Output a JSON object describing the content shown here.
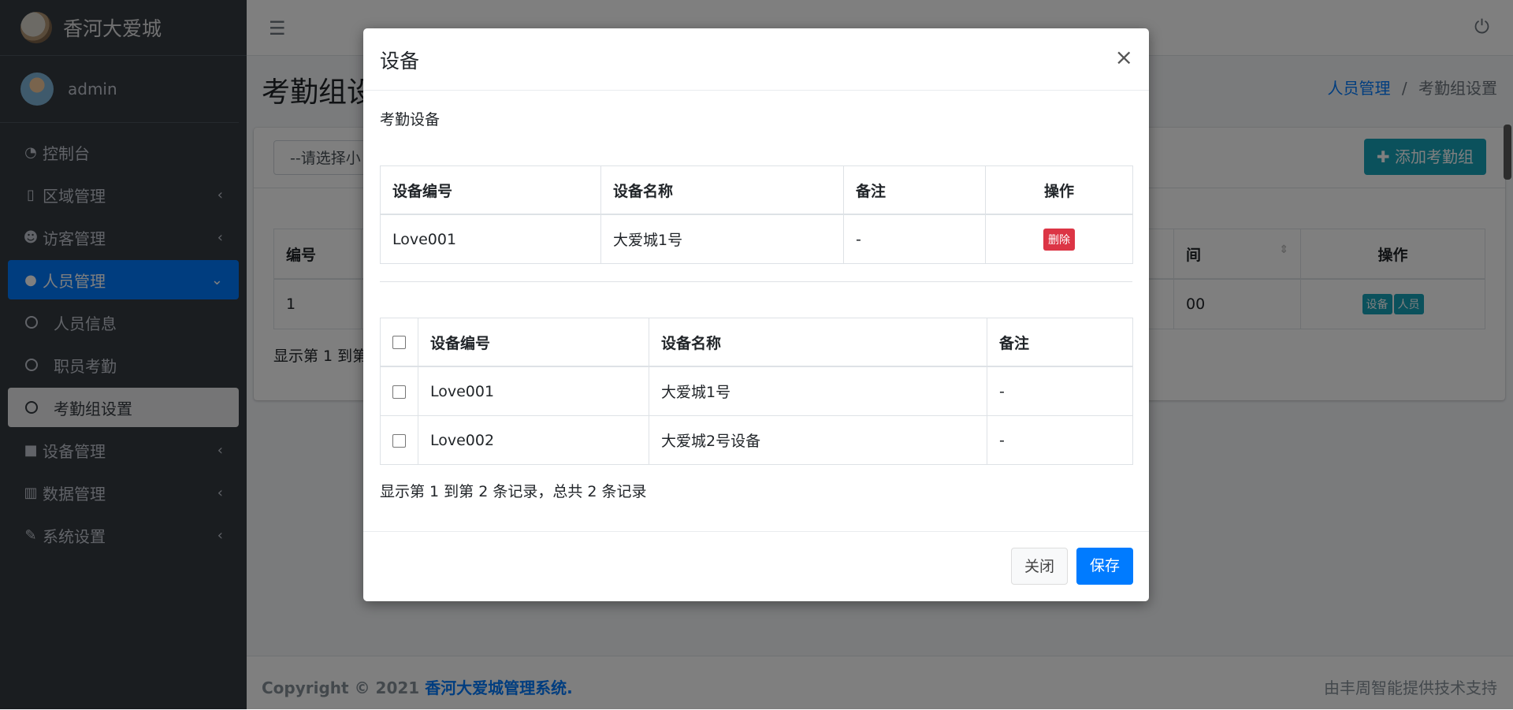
{
  "brand": {
    "name": "香河大爱城"
  },
  "user": {
    "name": "admin"
  },
  "sidebar": {
    "items": [
      {
        "label": "控制台",
        "icon": "dashboard-icon"
      },
      {
        "label": "区域管理",
        "icon": "building-icon"
      },
      {
        "label": "访客管理",
        "icon": "user-check-icon"
      },
      {
        "label": "人员管理",
        "icon": "user-icon"
      },
      {
        "label": "人员信息"
      },
      {
        "label": "职员考勤"
      },
      {
        "label": "考勤组设置"
      },
      {
        "label": "设备管理",
        "icon": "video-icon"
      },
      {
        "label": "数据管理",
        "icon": "chart-icon"
      },
      {
        "label": "系统设置",
        "icon": "wrench-icon"
      }
    ]
  },
  "page": {
    "title": "考勤组设",
    "breadcrumb": {
      "parent": "人员管理",
      "separator": "/",
      "current": "考勤组设置"
    },
    "filter_placeholder": "--请选择小",
    "add_button": "添加考勤组",
    "table": {
      "headers": [
        "编号",
        "间",
        "操作"
      ],
      "row": {
        "id": "1",
        "time": "00",
        "btn_device": "设备",
        "btn_person": "人员"
      }
    },
    "info": "显示第 1 到第"
  },
  "footer": {
    "copyright": "Copyright © 2021",
    "system_name": "香河大爱城管理系统.",
    "support": "由丰周智能提供技术支持"
  },
  "modal": {
    "title": "设备",
    "close_symbol": "×",
    "section_label": "考勤设备",
    "assigned": {
      "headers": [
        "设备编号",
        "设备名称",
        "备注",
        "操作"
      ],
      "rows": [
        {
          "code": "Love001",
          "name": "大爱城1号",
          "remark": "-",
          "action": "删除"
        }
      ]
    },
    "available": {
      "headers": [
        "设备编号",
        "设备名称",
        "备注"
      ],
      "rows": [
        {
          "code": "Love001",
          "name": "大爱城1号",
          "remark": "-"
        },
        {
          "code": "Love002",
          "name": "大爱城2号设备",
          "remark": "-"
        }
      ]
    },
    "info": "显示第 1 到第 2 条记录，总共 2 条记录",
    "close_button": "关闭",
    "save_button": "保存"
  },
  "colors": {
    "primary": "#007bff",
    "info": "#17a2b8",
    "danger": "#dc3545",
    "sidebar": "#343a40"
  }
}
